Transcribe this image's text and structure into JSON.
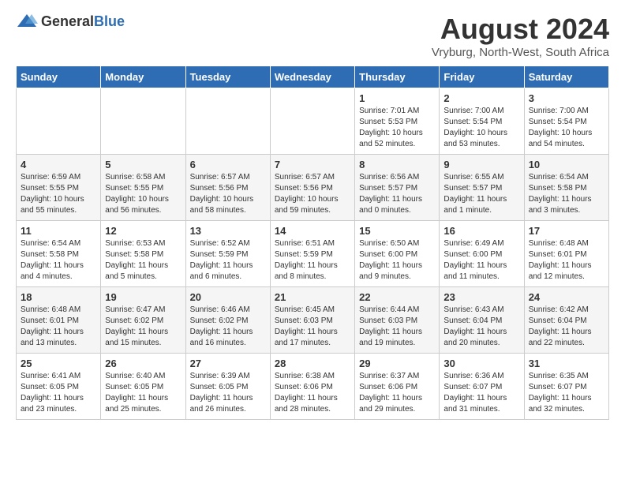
{
  "logo": {
    "general": "General",
    "blue": "Blue"
  },
  "title": "August 2024",
  "location": "Vryburg, North-West, South Africa",
  "weekdays": [
    "Sunday",
    "Monday",
    "Tuesday",
    "Wednesday",
    "Thursday",
    "Friday",
    "Saturday"
  ],
  "weeks": [
    [
      {
        "day": "",
        "detail": ""
      },
      {
        "day": "",
        "detail": ""
      },
      {
        "day": "",
        "detail": ""
      },
      {
        "day": "",
        "detail": ""
      },
      {
        "day": "1",
        "detail": "Sunrise: 7:01 AM\nSunset: 5:53 PM\nDaylight: 10 hours\nand 52 minutes."
      },
      {
        "day": "2",
        "detail": "Sunrise: 7:00 AM\nSunset: 5:54 PM\nDaylight: 10 hours\nand 53 minutes."
      },
      {
        "day": "3",
        "detail": "Sunrise: 7:00 AM\nSunset: 5:54 PM\nDaylight: 10 hours\nand 54 minutes."
      }
    ],
    [
      {
        "day": "4",
        "detail": "Sunrise: 6:59 AM\nSunset: 5:55 PM\nDaylight: 10 hours\nand 55 minutes."
      },
      {
        "day": "5",
        "detail": "Sunrise: 6:58 AM\nSunset: 5:55 PM\nDaylight: 10 hours\nand 56 minutes."
      },
      {
        "day": "6",
        "detail": "Sunrise: 6:57 AM\nSunset: 5:56 PM\nDaylight: 10 hours\nand 58 minutes."
      },
      {
        "day": "7",
        "detail": "Sunrise: 6:57 AM\nSunset: 5:56 PM\nDaylight: 10 hours\nand 59 minutes."
      },
      {
        "day": "8",
        "detail": "Sunrise: 6:56 AM\nSunset: 5:57 PM\nDaylight: 11 hours\nand 0 minutes."
      },
      {
        "day": "9",
        "detail": "Sunrise: 6:55 AM\nSunset: 5:57 PM\nDaylight: 11 hours\nand 1 minute."
      },
      {
        "day": "10",
        "detail": "Sunrise: 6:54 AM\nSunset: 5:58 PM\nDaylight: 11 hours\nand 3 minutes."
      }
    ],
    [
      {
        "day": "11",
        "detail": "Sunrise: 6:54 AM\nSunset: 5:58 PM\nDaylight: 11 hours\nand 4 minutes."
      },
      {
        "day": "12",
        "detail": "Sunrise: 6:53 AM\nSunset: 5:58 PM\nDaylight: 11 hours\nand 5 minutes."
      },
      {
        "day": "13",
        "detail": "Sunrise: 6:52 AM\nSunset: 5:59 PM\nDaylight: 11 hours\nand 6 minutes."
      },
      {
        "day": "14",
        "detail": "Sunrise: 6:51 AM\nSunset: 5:59 PM\nDaylight: 11 hours\nand 8 minutes."
      },
      {
        "day": "15",
        "detail": "Sunrise: 6:50 AM\nSunset: 6:00 PM\nDaylight: 11 hours\nand 9 minutes."
      },
      {
        "day": "16",
        "detail": "Sunrise: 6:49 AM\nSunset: 6:00 PM\nDaylight: 11 hours\nand 11 minutes."
      },
      {
        "day": "17",
        "detail": "Sunrise: 6:48 AM\nSunset: 6:01 PM\nDaylight: 11 hours\nand 12 minutes."
      }
    ],
    [
      {
        "day": "18",
        "detail": "Sunrise: 6:48 AM\nSunset: 6:01 PM\nDaylight: 11 hours\nand 13 minutes."
      },
      {
        "day": "19",
        "detail": "Sunrise: 6:47 AM\nSunset: 6:02 PM\nDaylight: 11 hours\nand 15 minutes."
      },
      {
        "day": "20",
        "detail": "Sunrise: 6:46 AM\nSunset: 6:02 PM\nDaylight: 11 hours\nand 16 minutes."
      },
      {
        "day": "21",
        "detail": "Sunrise: 6:45 AM\nSunset: 6:03 PM\nDaylight: 11 hours\nand 17 minutes."
      },
      {
        "day": "22",
        "detail": "Sunrise: 6:44 AM\nSunset: 6:03 PM\nDaylight: 11 hours\nand 19 minutes."
      },
      {
        "day": "23",
        "detail": "Sunrise: 6:43 AM\nSunset: 6:04 PM\nDaylight: 11 hours\nand 20 minutes."
      },
      {
        "day": "24",
        "detail": "Sunrise: 6:42 AM\nSunset: 6:04 PM\nDaylight: 11 hours\nand 22 minutes."
      }
    ],
    [
      {
        "day": "25",
        "detail": "Sunrise: 6:41 AM\nSunset: 6:05 PM\nDaylight: 11 hours\nand 23 minutes."
      },
      {
        "day": "26",
        "detail": "Sunrise: 6:40 AM\nSunset: 6:05 PM\nDaylight: 11 hours\nand 25 minutes."
      },
      {
        "day": "27",
        "detail": "Sunrise: 6:39 AM\nSunset: 6:05 PM\nDaylight: 11 hours\nand 26 minutes."
      },
      {
        "day": "28",
        "detail": "Sunrise: 6:38 AM\nSunset: 6:06 PM\nDaylight: 11 hours\nand 28 minutes."
      },
      {
        "day": "29",
        "detail": "Sunrise: 6:37 AM\nSunset: 6:06 PM\nDaylight: 11 hours\nand 29 minutes."
      },
      {
        "day": "30",
        "detail": "Sunrise: 6:36 AM\nSunset: 6:07 PM\nDaylight: 11 hours\nand 31 minutes."
      },
      {
        "day": "31",
        "detail": "Sunrise: 6:35 AM\nSunset: 6:07 PM\nDaylight: 11 hours\nand 32 minutes."
      }
    ]
  ]
}
